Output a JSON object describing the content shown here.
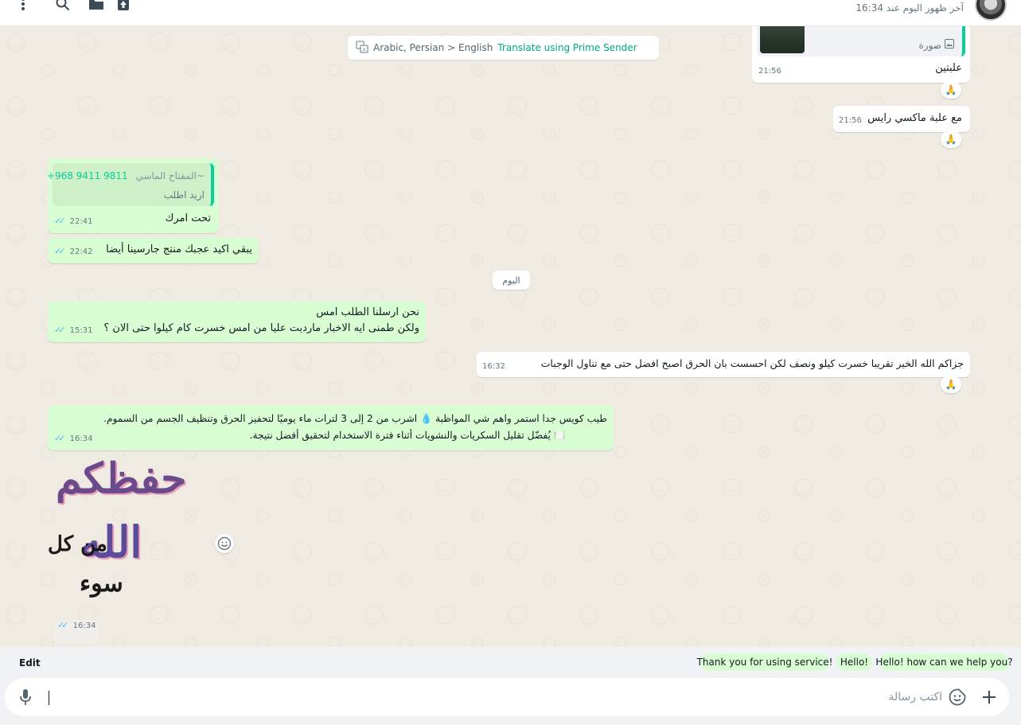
{
  "header": {
    "status": "آخر ظهور اليوم عند 16:34"
  },
  "translate_bar": {
    "languages": "Arabic, Persian > English",
    "action": "Translate using Prime Sender"
  },
  "messages": {
    "m1": {
      "image_caption": "صورة",
      "text": "علبتين",
      "time": "21:56",
      "reaction": "🙏"
    },
    "m2": {
      "text": "مع علبة ماكسي رايس",
      "time": "21:56",
      "reaction": "🙏"
    },
    "m3": {
      "quote_phone": "+968 9411 9811",
      "quote_name": "~المفتاح الماسي",
      "quote_text": "اريد اطلب",
      "text": "تحت امرك",
      "time": "22:41"
    },
    "m4": {
      "text": "يبقي اكيد عجبك منتج جارسينا أيضا",
      "time": "22:42"
    },
    "day_separator": "اليوم",
    "m5": {
      "line1": "نحن ارسلنا الطلب امس",
      "line2": "ولكن طمنى ايه الاخبار ماردبت عليا من امس خسرت كام كيلوا حتى الان ؟",
      "time": "15:31"
    },
    "m6": {
      "text": "جزاكم الله الخير تقريبا خسرت كيلو ونصف لكن احسست بان الحرق اصبح افضل حتى مع تناول الوجبات",
      "time": "16:32",
      "reaction": "🙏"
    },
    "m7": {
      "line1": "طيب كويس جدا استمر واهم شي المواظبة 💧 اشرب من 2 إلى 3 لترات ماء يوميًا لتحفيز الحرق وتنظيف الجسم من السموم.",
      "line2": "🍽️ يُفضّل تقليل السكريات والنشويات أثناء فترة الاستخدام لتحقيق أفضل نتيجة.",
      "time": "16:34"
    },
    "sticker": {
      "text_line1": "حفظكم",
      "text_line2": "الله",
      "text_line3": "من كل",
      "text_line4": "سوء",
      "time": "16:34"
    }
  },
  "quick_replies": {
    "edit_label": "Edit",
    "chips": [
      "Thank you for using service!",
      "Hello!",
      "Hello! how can we help you?"
    ]
  },
  "composer": {
    "placeholder": "اكتب رسالة"
  },
  "colors": {
    "outgoing_bubble": "#d9fdd3",
    "incoming_bubble": "#ffffff",
    "chat_background": "#efeae2",
    "accent": "#00a884",
    "read_ticks": "#53bdeb"
  },
  "icons": [
    "menu-dots-icon",
    "search-icon",
    "folder-icon",
    "upload-icon",
    "microphone-icon",
    "sticker-icon",
    "plus-icon",
    "emoji-icon",
    "translate-icon",
    "image-icon"
  ]
}
